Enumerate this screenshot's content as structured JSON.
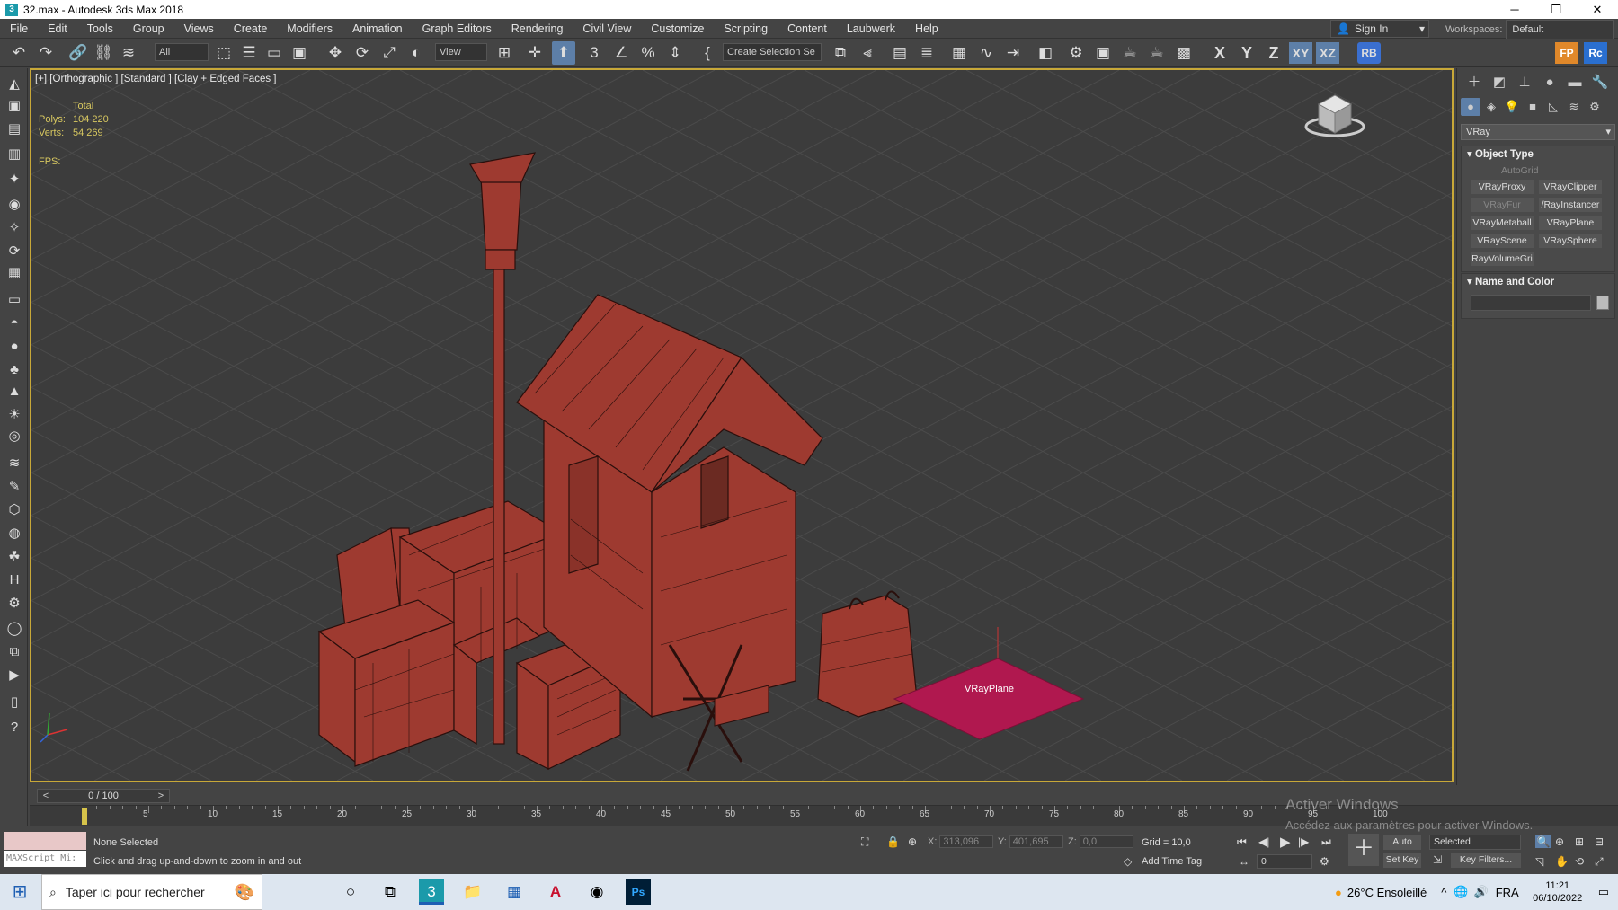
{
  "window": {
    "title": "32.max - Autodesk 3ds Max 2018",
    "app_icon": "3"
  },
  "menu": [
    "File",
    "Edit",
    "Tools",
    "Group",
    "Views",
    "Create",
    "Modifiers",
    "Animation",
    "Graph Editors",
    "Rendering",
    "Civil View",
    "Customize",
    "Scripting",
    "Content",
    "Laubwerk",
    "Help"
  ],
  "account": {
    "sign_in": "Sign In",
    "workspaces_label": "Workspaces:",
    "workspace_value": "Default"
  },
  "toolbar": {
    "filter": "All",
    "ref_coord": "View",
    "named_selection": "Create Selection Se",
    "axis_x": "X",
    "axis_y": "Y",
    "axis_z": "Z",
    "axis_xy": "XY",
    "axis_xz": "XZ",
    "rb": "RB",
    "fp": "FP",
    "rc": "Rc"
  },
  "viewport": {
    "label": "[+] [Orthographic ] [Standard ] [Clay + Edged Faces ]",
    "stats_total": "Total",
    "polys_label": "Polys:",
    "polys_value": "104 220",
    "verts_label": "Verts:",
    "verts_value": "54 269",
    "fps_label": "FPS:",
    "vrayplane_label": "VRayPlane",
    "mesh_color": "#9e3a30",
    "plane_color": "#b0184f"
  },
  "command_panel": {
    "category": "VRay",
    "object_type_title": "Object Type",
    "autogrid": "AutoGrid",
    "buttons": [
      {
        "label": "VRayProxy",
        "enabled": true
      },
      {
        "label": "VRayClipper",
        "enabled": true
      },
      {
        "label": "VRayFur",
        "enabled": false
      },
      {
        "label": "/RayInstancer",
        "enabled": true
      },
      {
        "label": "VRayMetaball",
        "enabled": true
      },
      {
        "label": "VRayPlane",
        "enabled": true
      },
      {
        "label": "VRayScene",
        "enabled": true
      },
      {
        "label": "VRaySphere",
        "enabled": true
      },
      {
        "label": "RayVolumeGri",
        "enabled": true
      }
    ],
    "name_color_title": "Name and Color"
  },
  "timeline": {
    "slider": "0 / 100",
    "ticks": [
      "0",
      "5",
      "10",
      "15",
      "20",
      "25",
      "30",
      "35",
      "40",
      "45",
      "50",
      "55",
      "60",
      "65",
      "70",
      "75",
      "80",
      "85",
      "90",
      "95",
      "100"
    ]
  },
  "status": {
    "maxscript": "MAXScript Mi:",
    "selection": "None Selected",
    "prompt": "Click and drag up-and-down to zoom in and out",
    "x_label": "X:",
    "x_value": "313,096",
    "y_label": "Y:",
    "y_value": "401,695",
    "z_label": "Z:",
    "z_value": "0,0",
    "grid": "Grid = 10,0",
    "add_time_tag": "Add Time Tag",
    "auto_key": "Auto Key",
    "set_key": "Set Key",
    "key_mode": "Selected",
    "key_filters": "Key Filters...",
    "frame": "0"
  },
  "watermark": {
    "line1": "Activer Windows",
    "line2": "Accédez aux paramètres pour activer Windows."
  },
  "taskbar": {
    "search_placeholder": "Taper ici pour rechercher",
    "weather": "26°C  Ensoleillé",
    "lang": "FRA",
    "time": "11:21",
    "date": "06/10/2022"
  }
}
